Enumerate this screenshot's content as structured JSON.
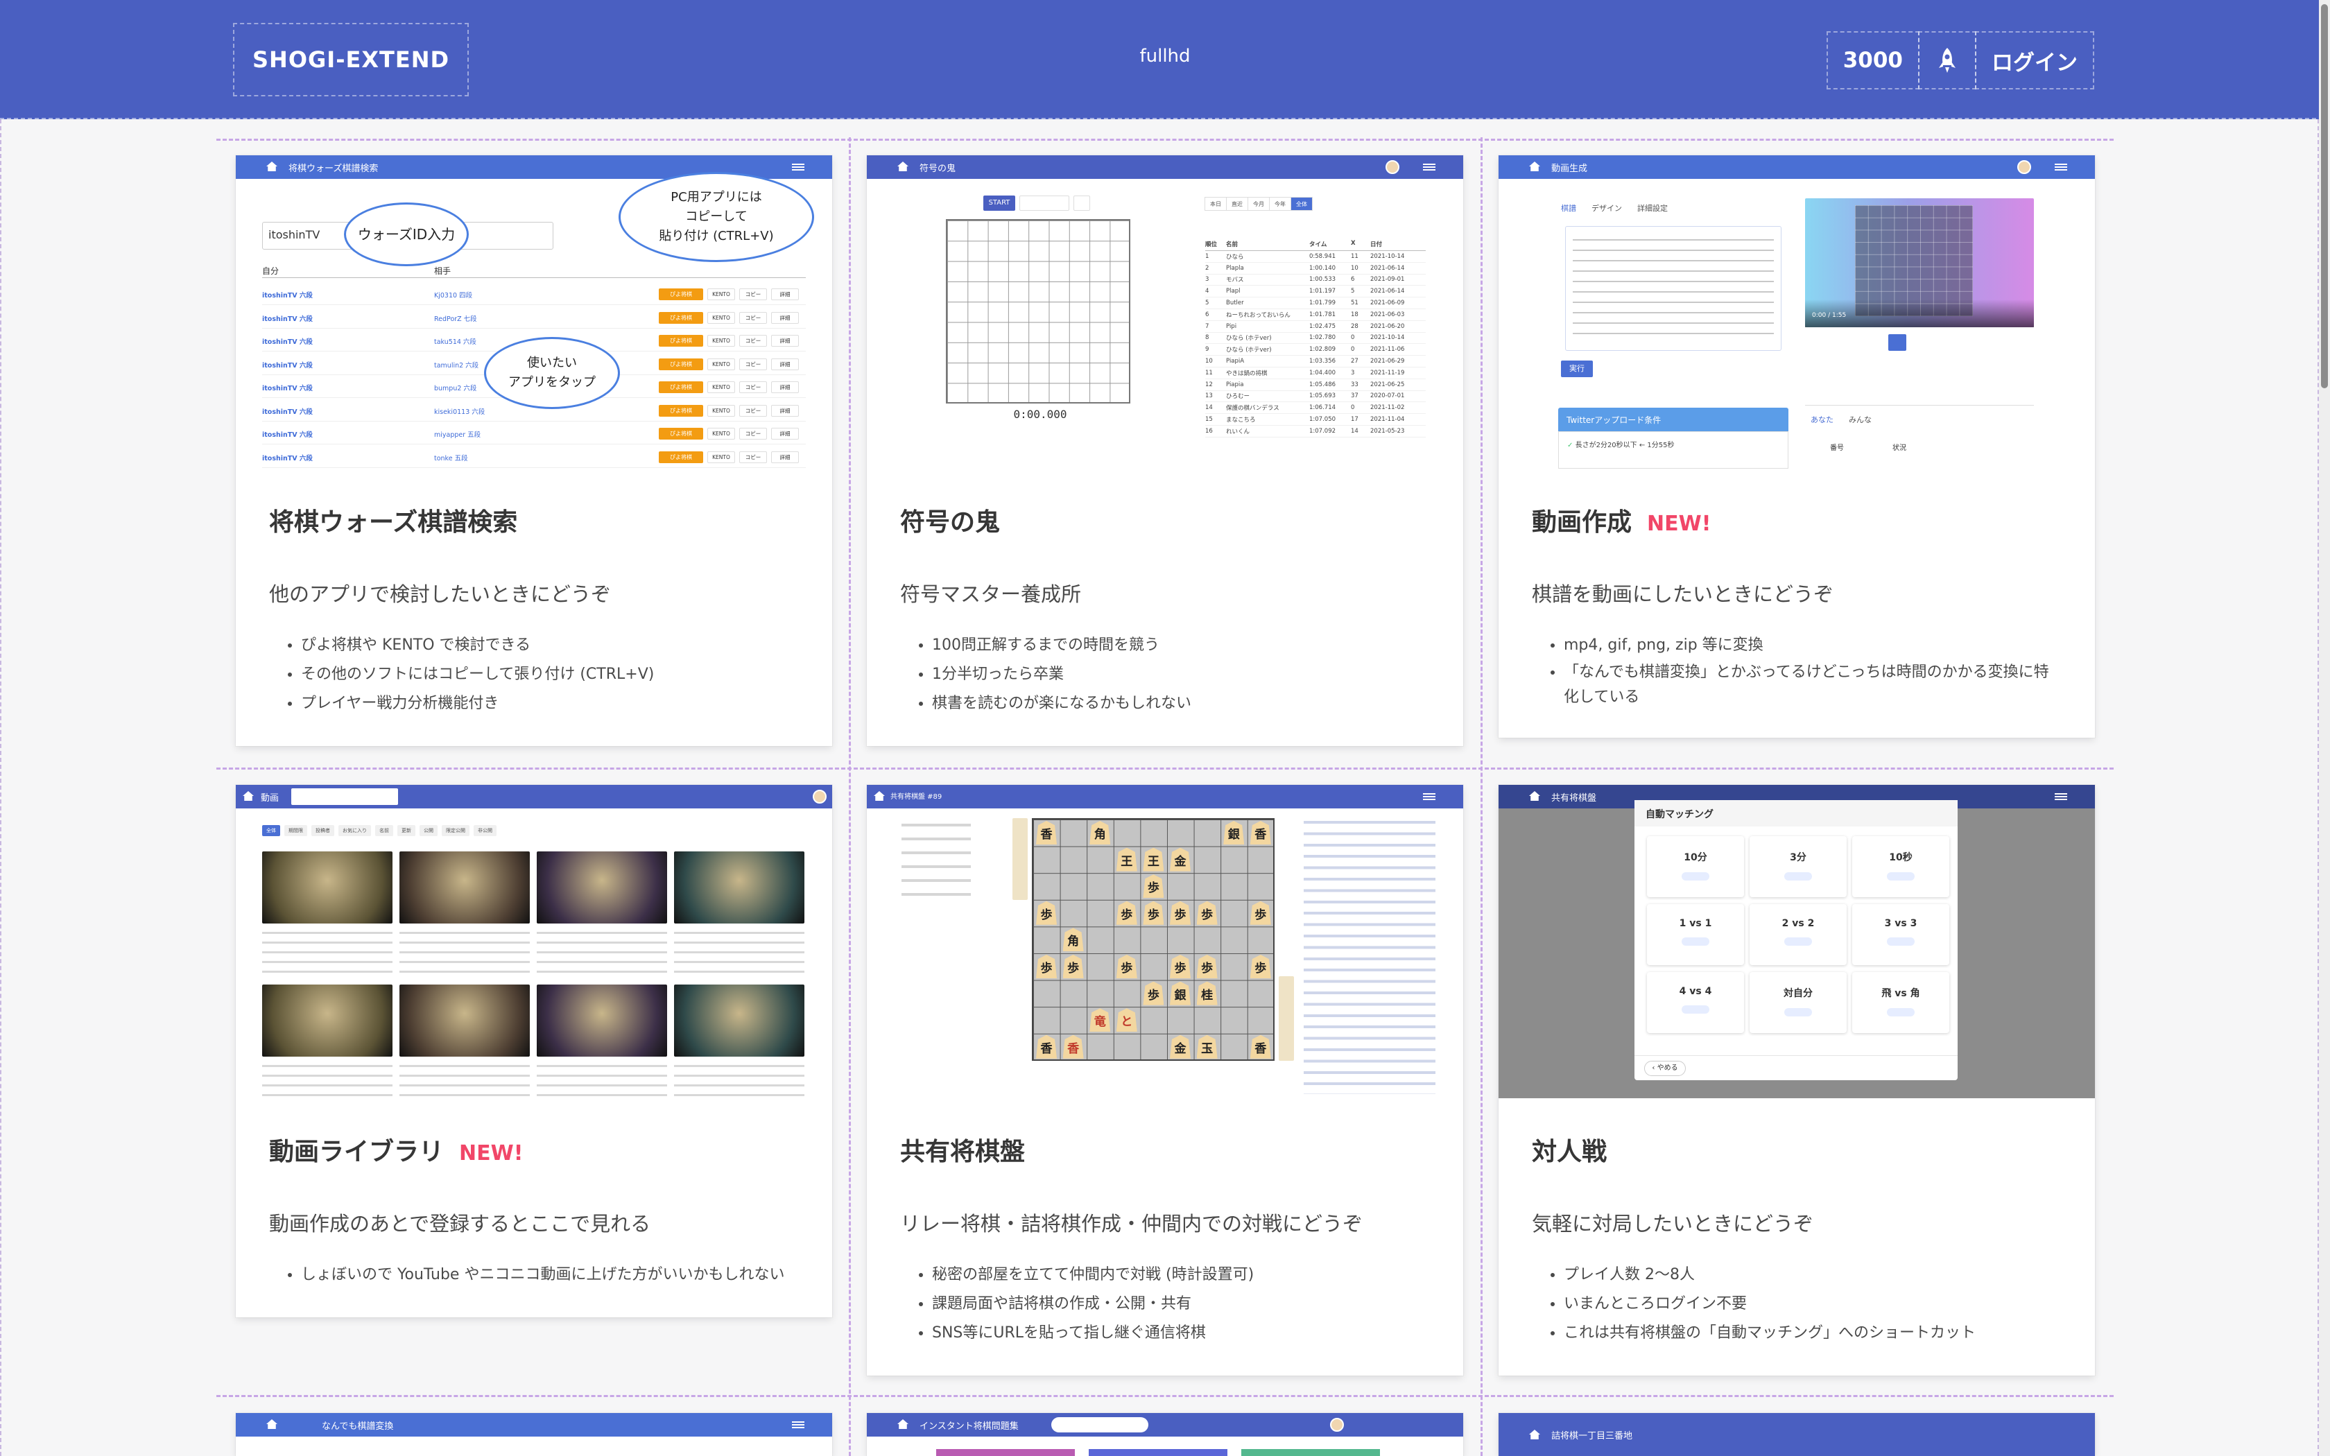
{
  "navbar": {
    "brand": "SHOGI-EXTEND",
    "center_label": "fullhd",
    "counter": "3000",
    "login_label": "ログイン",
    "rocket_icon": "rocket-icon",
    "bg_color": "#4a5fc1"
  },
  "cards": [
    {
      "title": "将棋ウォーズ棋譜検索",
      "is_new": false,
      "description": "他のアプリで検討したいときにどうぞ",
      "bullets": [
        "ぴよ将棋や KENTO で検討できる",
        "その他のソフトにはコピーして張り付け (CTRL+V)",
        "プレイヤー戦力分析機能付き"
      ]
    },
    {
      "title": "符号の鬼",
      "is_new": false,
      "description": "符号マスター養成所",
      "bullets": [
        "100問正解するまでの時間を競う",
        "1分半切ったら卒業",
        "棋書を読むのが楽になるかもしれない"
      ]
    },
    {
      "title": "動画作成",
      "is_new": true,
      "description": "棋譜を動画にしたいときにどうぞ",
      "bullets": [
        "mp4, gif, png, zip 等に変換",
        "「なんでも棋譜変換」とかぶってるけどこっちは時間のかかる変換に特化している"
      ]
    },
    {
      "title": "動画ライブラリ",
      "is_new": true,
      "description": "動画作成のあとで登録するとここで見れる",
      "bullets": [
        "しょぼいので YouTube やニコニコ動画に上げた方がいいかもしれない"
      ]
    },
    {
      "title": "共有将棋盤",
      "is_new": false,
      "description": "リレー将棋・詰将棋作成・仲間内での対戦にどうぞ",
      "bullets": [
        "秘密の部屋を立てて仲間内で対戦 (時計設置可)",
        "課題局面や詰将棋の作成・公開・共有",
        "SNS等にURLを貼って指し継ぐ通信将棋"
      ]
    },
    {
      "title": "対人戦",
      "is_new": false,
      "description": "気軽に対局したいときにどうぞ",
      "bullets": [
        "プレイ人数 2〜8人",
        "いまんところログイン不要",
        "これは共有将棋盤の「自動マッチング」へのショートカット"
      ]
    }
  ],
  "new_label": "NEW!",
  "thumbs": {
    "swars": {
      "header": "将棋ウォーズ棋譜検索",
      "search_value": "itoshinTV",
      "bubble_id": "ウォーズID入力",
      "bubble_pc_lines": [
        "PC用アプリには",
        "コピーして",
        "貼り付け (CTRL+V)"
      ],
      "bubble_tap_lines": [
        "使いたい",
        "アプリをタップ"
      ],
      "col_self": "自分",
      "col_opponent": "相手",
      "rows": [
        {
          "self": "itoshinTV 六段",
          "opp": "Kj0310 四段",
          "badge_a": "ぴよ将棋",
          "badge_b": "KENTO",
          "badge_c": "コピー",
          "badge_d": "詳細"
        },
        {
          "self": "itoshinTV 六段",
          "opp": "RedPorZ 七段",
          "badge_a": "ぴよ将棋",
          "badge_b": "KENTO",
          "badge_c": "コピー",
          "badge_d": "詳細"
        },
        {
          "self": "itoshinTV 六段",
          "opp": "taku514 六段",
          "badge_a": "ぴよ将棋",
          "badge_b": "KENTO",
          "badge_c": "コピー",
          "badge_d": "詳細"
        },
        {
          "self": "itoshinTV 六段",
          "opp": "tamulin2 六段",
          "badge_a": "ぴよ将棋",
          "badge_b": "KENTO",
          "badge_c": "コピー",
          "badge_d": "詳細"
        },
        {
          "self": "itoshinTV 六段",
          "opp": "bumpu2 六段",
          "badge_a": "ぴよ将棋",
          "badge_b": "KENTO",
          "badge_c": "コピー",
          "badge_d": "詳細"
        },
        {
          "self": "itoshinTV 六段",
          "opp": "kiseki0113 六段",
          "badge_a": "ぴよ将棋",
          "badge_b": "KENTO",
          "badge_c": "コピー",
          "badge_d": "詳細"
        },
        {
          "self": "itoshinTV 六段",
          "opp": "miyapper 五段",
          "badge_a": "ぴよ将棋",
          "badge_b": "KENTO",
          "badge_c": "コピー",
          "badge_d": "詳細"
        },
        {
          "self": "itoshinTV 六段",
          "opp": "tonke 五段",
          "badge_a": "ぴよ将棋",
          "badge_b": "KENTO",
          "badge_c": "コピー",
          "badge_d": "詳細"
        }
      ]
    },
    "fugo": {
      "header": "符号の鬼",
      "start_label": "START",
      "timer": "0:00.000",
      "tabs": [
        "本日",
        "直近",
        "今月",
        "今年",
        "全体"
      ],
      "cols": [
        "順位",
        "名前",
        "タイム",
        "X",
        "日付"
      ],
      "rows": [
        [
          "1",
          "ひなら",
          "0:58.941",
          "11",
          "2021-10-14"
        ],
        [
          "2",
          "Plapla",
          "1:00.140",
          "10",
          "2021-06-14"
        ],
        [
          "3",
          "モバス",
          "1:00.533",
          "6",
          "2021-09-01"
        ],
        [
          "4",
          "Plapl",
          "1:01.197",
          "5",
          "2021-06-14"
        ],
        [
          "5",
          "Butler",
          "1:01.799",
          "51",
          "2021-06-09"
        ],
        [
          "6",
          "ねーちれおっておいらん",
          "1:01.781",
          "18",
          "2021-06-03"
        ],
        [
          "7",
          "Pipi",
          "1:02.475",
          "28",
          "2021-06-20"
        ],
        [
          "8",
          "ひなら (ホテver)",
          "1:02.780",
          "0",
          "2021-10-14"
        ],
        [
          "9",
          "ひなら (ホテver)",
          "1:02.809",
          "0",
          "2021-11-06"
        ],
        [
          "10",
          "PiapiA",
          "1:03.356",
          "27",
          "2021-06-29"
        ],
        [
          "11",
          "やきは鍋の将棋",
          "1:04.400",
          "3",
          "2021-11-19"
        ],
        [
          "12",
          "Piapia",
          "1:05.486",
          "33",
          "2021-06-25"
        ],
        [
          "13",
          "ひろむー",
          "1:05.693",
          "37",
          "2020-07-01"
        ],
        [
          "14",
          "保護の棋バンデラス",
          "1:06.714",
          "0",
          "2021-11-02"
        ],
        [
          "15",
          "まなこちろ",
          "1:07.050",
          "17",
          "2021-11-04"
        ],
        [
          "16",
          "れいくん",
          "1:07.092",
          "14",
          "2021-05-23"
        ]
      ]
    },
    "video": {
      "header": "動画生成",
      "tabs": [
        "棋譜",
        "デザイン",
        "詳細設定"
      ],
      "run_label": "実行",
      "twitter_panel": "Twitterアップロード条件",
      "twitter_item": "長さが2分20秒以下 ← 1分55秒",
      "player_time": "0:00 / 1:55",
      "side_tabs": [
        "あなた",
        "みんな"
      ],
      "side_cols": [
        "番号",
        "状況"
      ]
    },
    "library": {
      "header": "動画",
      "filters": [
        "全体",
        "期間限",
        "投稿者",
        "お気に入り",
        "名前",
        "更新",
        "公開",
        "限定公開",
        "非公開"
      ]
    },
    "shared": {
      "header": "共有将棋盤 #89"
    },
    "match": {
      "header": "共有将棋盤",
      "modal_title": "自動マッチング",
      "options": [
        "10分",
        "3分",
        "10秒",
        "1 vs 1",
        "2 vs 2",
        "3 vs 3",
        "4 vs 4",
        "対自分",
        "飛 vs 角"
      ],
      "cancel_label": "やめる"
    },
    "row3": [
      {
        "header": "なんでも棋譜変換"
      },
      {
        "header": "インスタント将棋問題集"
      },
      {
        "header": "詰将棋一丁目三番地"
      }
    ]
  }
}
